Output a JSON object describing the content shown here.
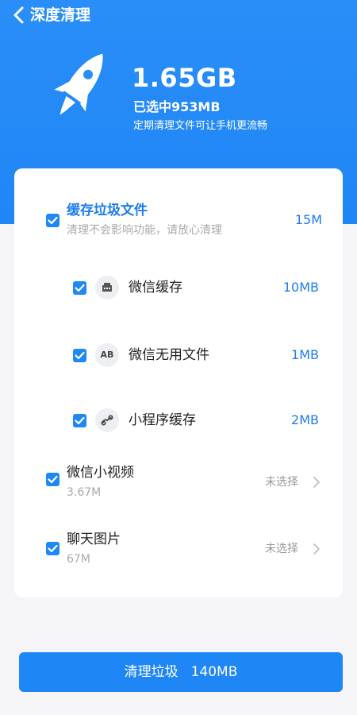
{
  "header": {
    "title": "深度清理",
    "total_size": "1.65GB",
    "selected_text": "已选中953MB",
    "tip": "定期清理文件可让手机更流畅"
  },
  "items": {
    "cache": {
      "title": "缓存垃圾文件",
      "subtitle": "清理不会影响功能，请放心清理",
      "size": "15M",
      "checked": true
    },
    "wechat_cache": {
      "title": "微信缓存",
      "size": "10MB",
      "checked": true,
      "icon": "keyboard-icon"
    },
    "wechat_unused": {
      "title": "微信无用文件",
      "size": "1MB",
      "checked": true,
      "icon_text": "AB",
      "icon": "ab-icon"
    },
    "miniapp_cache": {
      "title": "小程序缓存",
      "size": "2MB",
      "checked": true,
      "icon": "miniprogram-icon"
    },
    "wechat_video": {
      "title": "微信小视频",
      "size": "3.67M",
      "status": "未选择",
      "checked": true
    },
    "chat_images": {
      "title": "聊天图片",
      "size": "67M",
      "status": "未选择",
      "checked": true
    }
  },
  "action": {
    "label": "清理垃圾",
    "size": "140MB"
  },
  "colors": {
    "primary": "#1f86f5",
    "accent_text": "#1e7cf0",
    "background": "#f5f5f7"
  }
}
